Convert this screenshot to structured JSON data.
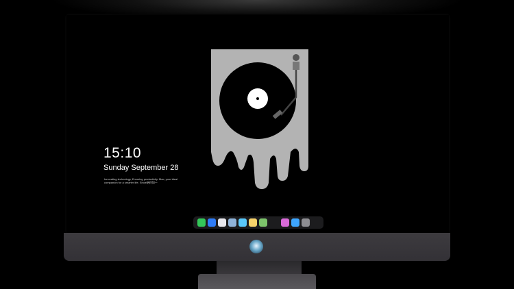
{
  "lockscreen": {
    "time": "15:10",
    "date": "Sunday September 28",
    "tagline": "Innovating technology, Ensuring productivity. Mac, your ideal companion for a smarter life. Since始终如一"
  },
  "dock": {
    "apps": [
      {
        "name": "messages-icon",
        "color": "#34c759"
      },
      {
        "name": "finder-icon",
        "color": "#2f7cf6"
      },
      {
        "name": "safari-icon",
        "color": "#e9e9ee"
      },
      {
        "name": "preview-icon",
        "color": "#8fb3d9"
      },
      {
        "name": "clapper-icon",
        "color": "#5ac8fa"
      },
      {
        "name": "notes-icon",
        "color": "#f7d36b"
      },
      {
        "name": "photos-icon",
        "color": "#7dc36b"
      },
      {
        "name": "music-icon",
        "color": "#d96bd9"
      },
      {
        "name": "app-store-icon",
        "color": "#3ea6ff"
      },
      {
        "name": "screenshot-icon",
        "color": "#8e8e93"
      }
    ]
  },
  "colors": {
    "art_bg": "#b3b3b3",
    "record": "#000000",
    "label": "#ffffff",
    "bezel": "#050505",
    "chin": "#3d3b3f"
  }
}
